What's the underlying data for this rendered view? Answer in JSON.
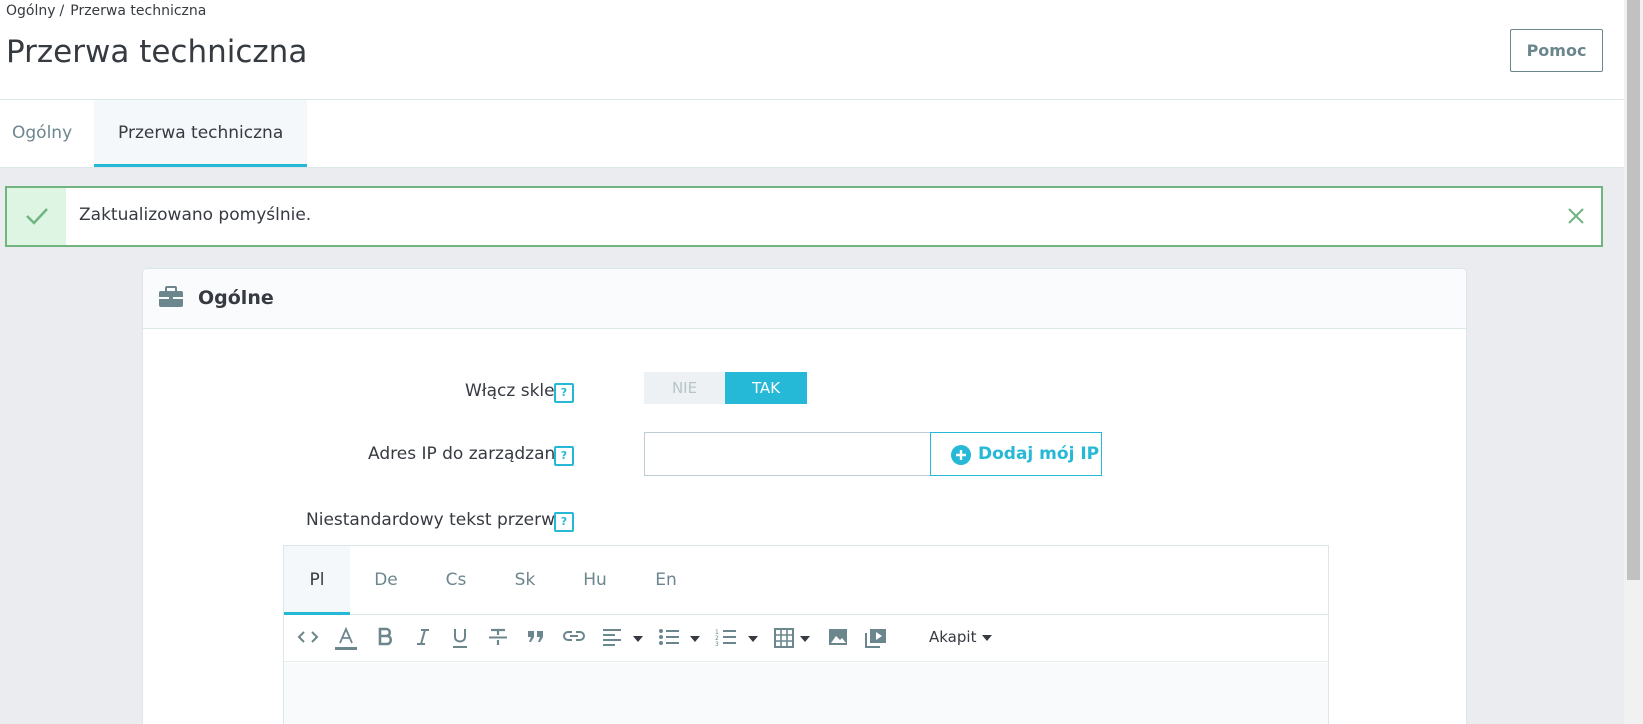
{
  "breadcrumb": {
    "parent": "Ogólny",
    "separator": "/",
    "current": "Przerwa techniczna"
  },
  "page": {
    "title": "Przerwa techniczna",
    "help_label": "Pomoc"
  },
  "tabs": [
    {
      "label": "Ogólny",
      "active": false
    },
    {
      "label": "Przerwa techniczna",
      "active": true
    }
  ],
  "alert": {
    "message": "Zaktualizowano pomyślnie.",
    "icon": "check-icon",
    "close_icon": "close-icon"
  },
  "card": {
    "title": "Ogólne",
    "icon": "briefcase-icon",
    "fields": {
      "enable_shop": {
        "label": "Włącz sklep",
        "help": "?",
        "option_no": "NIE",
        "option_yes": "TAK",
        "selected": "TAK"
      },
      "maintenance_ip": {
        "label": "Adres IP do zarządzania",
        "help": "?",
        "value": "",
        "add_button": "Dodaj mój IP"
      },
      "custom_text": {
        "label": "Niestandardowy tekst przerwy",
        "help": "?"
      }
    }
  },
  "editor": {
    "languages": [
      "Pl",
      "De",
      "Cs",
      "Sk",
      "Hu",
      "En"
    ],
    "active_language": "Pl",
    "toolbar": [
      "code-view-icon",
      "text-color-icon",
      "bold-icon",
      "italic-icon",
      "underline-icon",
      "strikethrough-icon",
      "blockquote-icon",
      "link-icon",
      "align-icon",
      "bullet-list-icon",
      "numbered-list-icon",
      "table-icon",
      "image-icon",
      "media-icon"
    ],
    "format_label": "Akapit"
  },
  "colors": {
    "accent": "#25b9d7",
    "success_border": "#70b580",
    "success_bg": "#dff5e3",
    "text": "#363a41",
    "muted": "#6c868e"
  }
}
